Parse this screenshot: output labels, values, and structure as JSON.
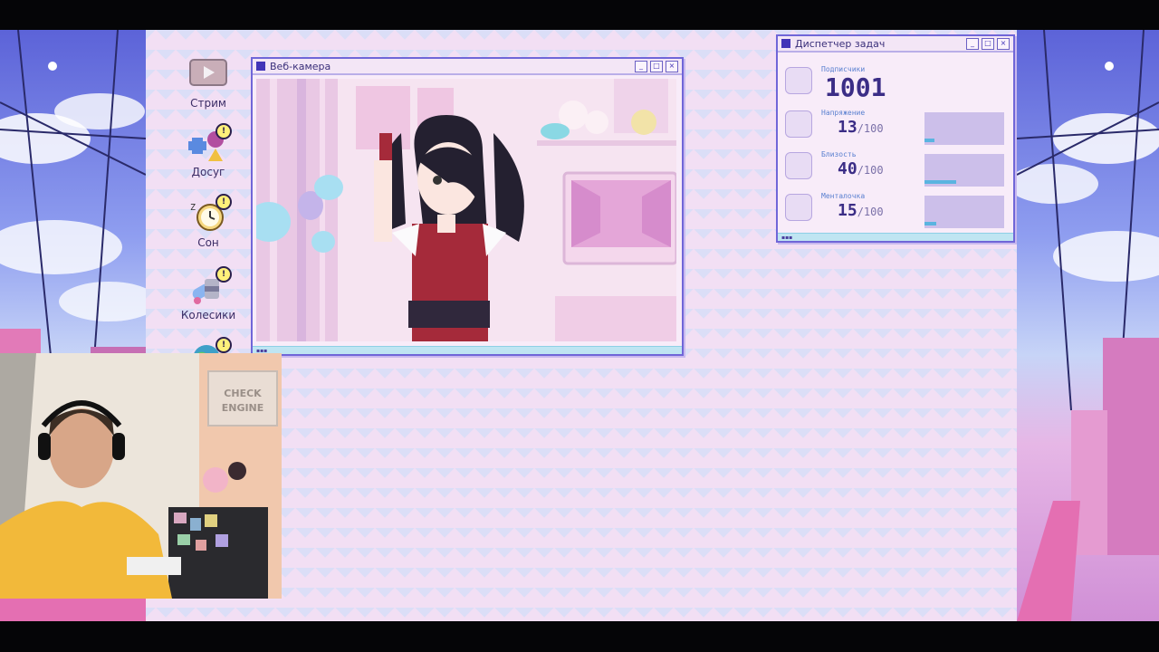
{
  "desktop_icons": [
    {
      "label": "Стрим",
      "icon": "stream-icon"
    },
    {
      "label": "Досуг",
      "icon": "leisure-icon"
    },
    {
      "label": "Сон",
      "icon": "alarm-clock-icon"
    },
    {
      "label": "Колесики",
      "icon": "pills-icon"
    },
    {
      "label": "",
      "icon": "internet-globe-icon"
    }
  ],
  "webcam_window": {
    "title": "Веб-камера"
  },
  "task_manager": {
    "title": "Диспетчер задач",
    "subscribers_label": "Подписчики",
    "subscribers_value": "1001",
    "stats": [
      {
        "label": "Напряжение",
        "value": "13",
        "max": "/100",
        "level": 0.13
      },
      {
        "label": "Близость",
        "value": "40",
        "max": "/100",
        "level": 0.4
      },
      {
        "label": "Менталочка",
        "value": "15",
        "max": "/100",
        "level": 0.15
      }
    ]
  },
  "streamer_cam": {
    "sign_text": "CHECK ENGINE"
  },
  "colors": {
    "window_border": "#7066d8",
    "accent_blue": "#5ab4e0",
    "bar_bg": "#ccbfea",
    "desktop_bg": "#f2dff4"
  }
}
